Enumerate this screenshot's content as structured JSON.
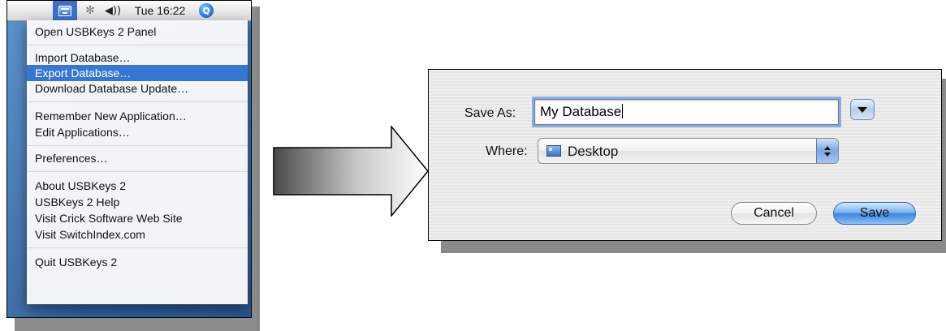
{
  "menubar": {
    "usb_icon": "usbkeys-icon",
    "bluetooth_icon": "bluetooth-icon",
    "bluetooth_glyph": "✻",
    "volume_icon": "volume-icon",
    "volume_glyph": "◀))",
    "clock": "Tue 16:22",
    "spotlight_icon": "spotlight-icon",
    "spotlight_glyph": "Q"
  },
  "menu": {
    "items": [
      {
        "label": "Open USBKeys 2 Panel",
        "selected": false
      },
      {
        "label": "Import Database…",
        "selected": false
      },
      {
        "label": "Export Database…",
        "selected": true
      },
      {
        "label": "Download Database Update…",
        "selected": false
      },
      {
        "label": "Remember New Application…",
        "selected": false
      },
      {
        "label": "Edit Applications…",
        "selected": false
      },
      {
        "label": "Preferences…",
        "selected": false
      },
      {
        "label": "About USBKeys 2",
        "selected": false
      },
      {
        "label": "USBKeys 2 Help",
        "selected": false
      },
      {
        "label": "Visit Crick Software Web Site",
        "selected": false
      },
      {
        "label": "Visit SwitchIndex.com",
        "selected": false
      },
      {
        "label": "Quit USBKeys 2",
        "selected": false
      }
    ]
  },
  "dialog": {
    "save_as_label": "Save As:",
    "save_as_value": "My Database",
    "where_label": "Where:",
    "where_value": "Desktop",
    "cancel_label": "Cancel",
    "save_label": "Save"
  },
  "colors": {
    "selection": "#3976d3",
    "desktop_blue": "#3f76b6",
    "default_button": "#3b86e0"
  }
}
